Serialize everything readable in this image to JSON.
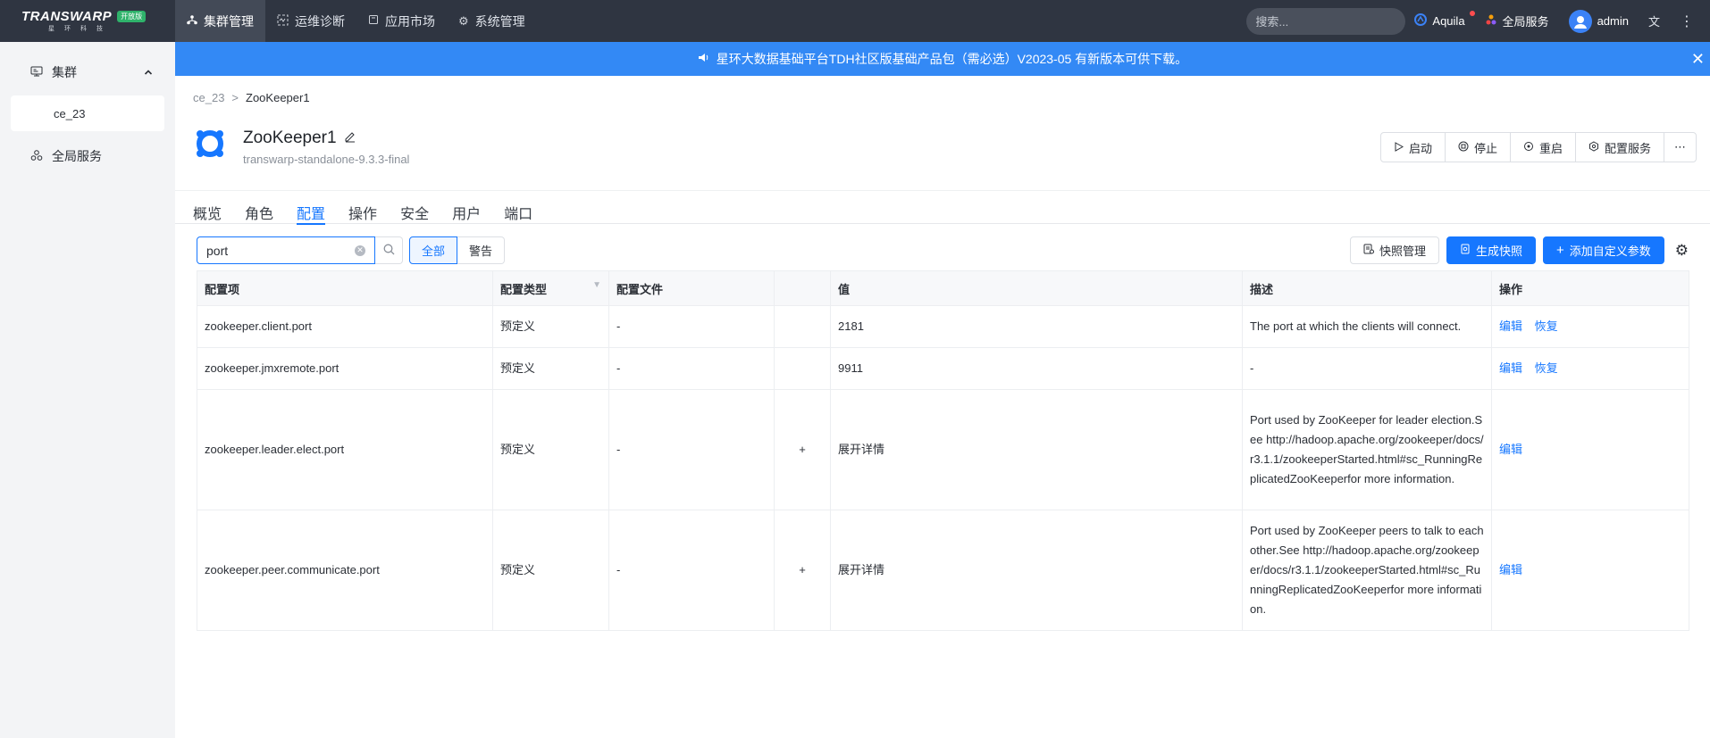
{
  "topbar": {
    "logo_text": "TRANSWARP",
    "logo_badge": "开放版",
    "logo_sub": "星环科技",
    "nav": [
      {
        "label": "集群管理",
        "icon": "cluster-icon",
        "active": true
      },
      {
        "label": "运维诊断",
        "icon": "diagnose-icon",
        "active": false
      },
      {
        "label": "应用市场",
        "icon": "market-icon",
        "active": false
      },
      {
        "label": "系统管理",
        "icon": "settings-icon",
        "active": false
      }
    ],
    "search_placeholder": "搜索...",
    "aquila": "Aquila",
    "global_services": "全局服务",
    "user": "admin"
  },
  "sidebar": {
    "group_label": "集群",
    "sub_item": "ce_23",
    "global_item": "全局服务"
  },
  "banner": {
    "text": "星环大数据基础平台TDH社区版基础产品包（需必选）V2023-05 有新版本可供下载。"
  },
  "breadcrumb": {
    "parent": "ce_23",
    "separator": ">",
    "current": "ZooKeeper1"
  },
  "service": {
    "title": "ZooKeeper1",
    "subtitle": "transwarp-standalone-9.3.3-final",
    "buttons": {
      "start": "启动",
      "stop": "停止",
      "restart": "重启",
      "configure": "配置服务"
    }
  },
  "tabs": [
    {
      "label": "概览",
      "active": false
    },
    {
      "label": "角色",
      "active": false
    },
    {
      "label": "配置",
      "active": true
    },
    {
      "label": "操作",
      "active": false
    },
    {
      "label": "安全",
      "active": false
    },
    {
      "label": "用户",
      "active": false
    },
    {
      "label": "端口",
      "active": false
    }
  ],
  "filter": {
    "search_value": "port",
    "seg_all": "全部",
    "seg_warn": "警告"
  },
  "actions": {
    "snapshot_manage": "快照管理",
    "generate_snapshot": "生成快照",
    "add_custom": "添加自定义参数"
  },
  "table": {
    "headers": {
      "item": "配置项",
      "type": "配置类型",
      "file": "配置文件",
      "expand": "",
      "value": "值",
      "desc": "描述",
      "ops": "操作"
    },
    "rows": [
      {
        "item": "zookeeper.client.port",
        "type": "预定义",
        "file": "-",
        "expand": "",
        "value": "2181",
        "desc": "The port at which the clients will connect.",
        "edit": "编辑",
        "restore": "恢复"
      },
      {
        "item": "zookeeper.jmxremote.port",
        "type": "预定义",
        "file": "-",
        "expand": "",
        "value": "9911",
        "desc": "-",
        "edit": "编辑",
        "restore": "恢复"
      },
      {
        "item": "zookeeper.leader.elect.port",
        "type": "预定义",
        "file": "-",
        "expand": "+",
        "value": "展开详情",
        "desc": "Port used by ZooKeeper for leader election.See http://hadoop.apache.org/zookeeper/docs/r3.1.1/zookeeperStarted.html#sc_RunningReplicatedZooKeeperfor more information.",
        "edit": "编辑",
        "restore": ""
      },
      {
        "item": "zookeeper.peer.communicate.port",
        "type": "预定义",
        "file": "-",
        "expand": "+",
        "value": "展开详情",
        "desc": "Port used by ZooKeeper peers to talk to each other.See http://hadoop.apache.org/zookeeper/docs/r3.1.1/zookeeperStarted.html#sc_RunningReplicatedZooKeeperfor more information.",
        "edit": "编辑",
        "restore": ""
      }
    ]
  },
  "colors": {
    "accent": "#1677ff",
    "banner": "#3389f5",
    "topbar": "#2f3541"
  }
}
